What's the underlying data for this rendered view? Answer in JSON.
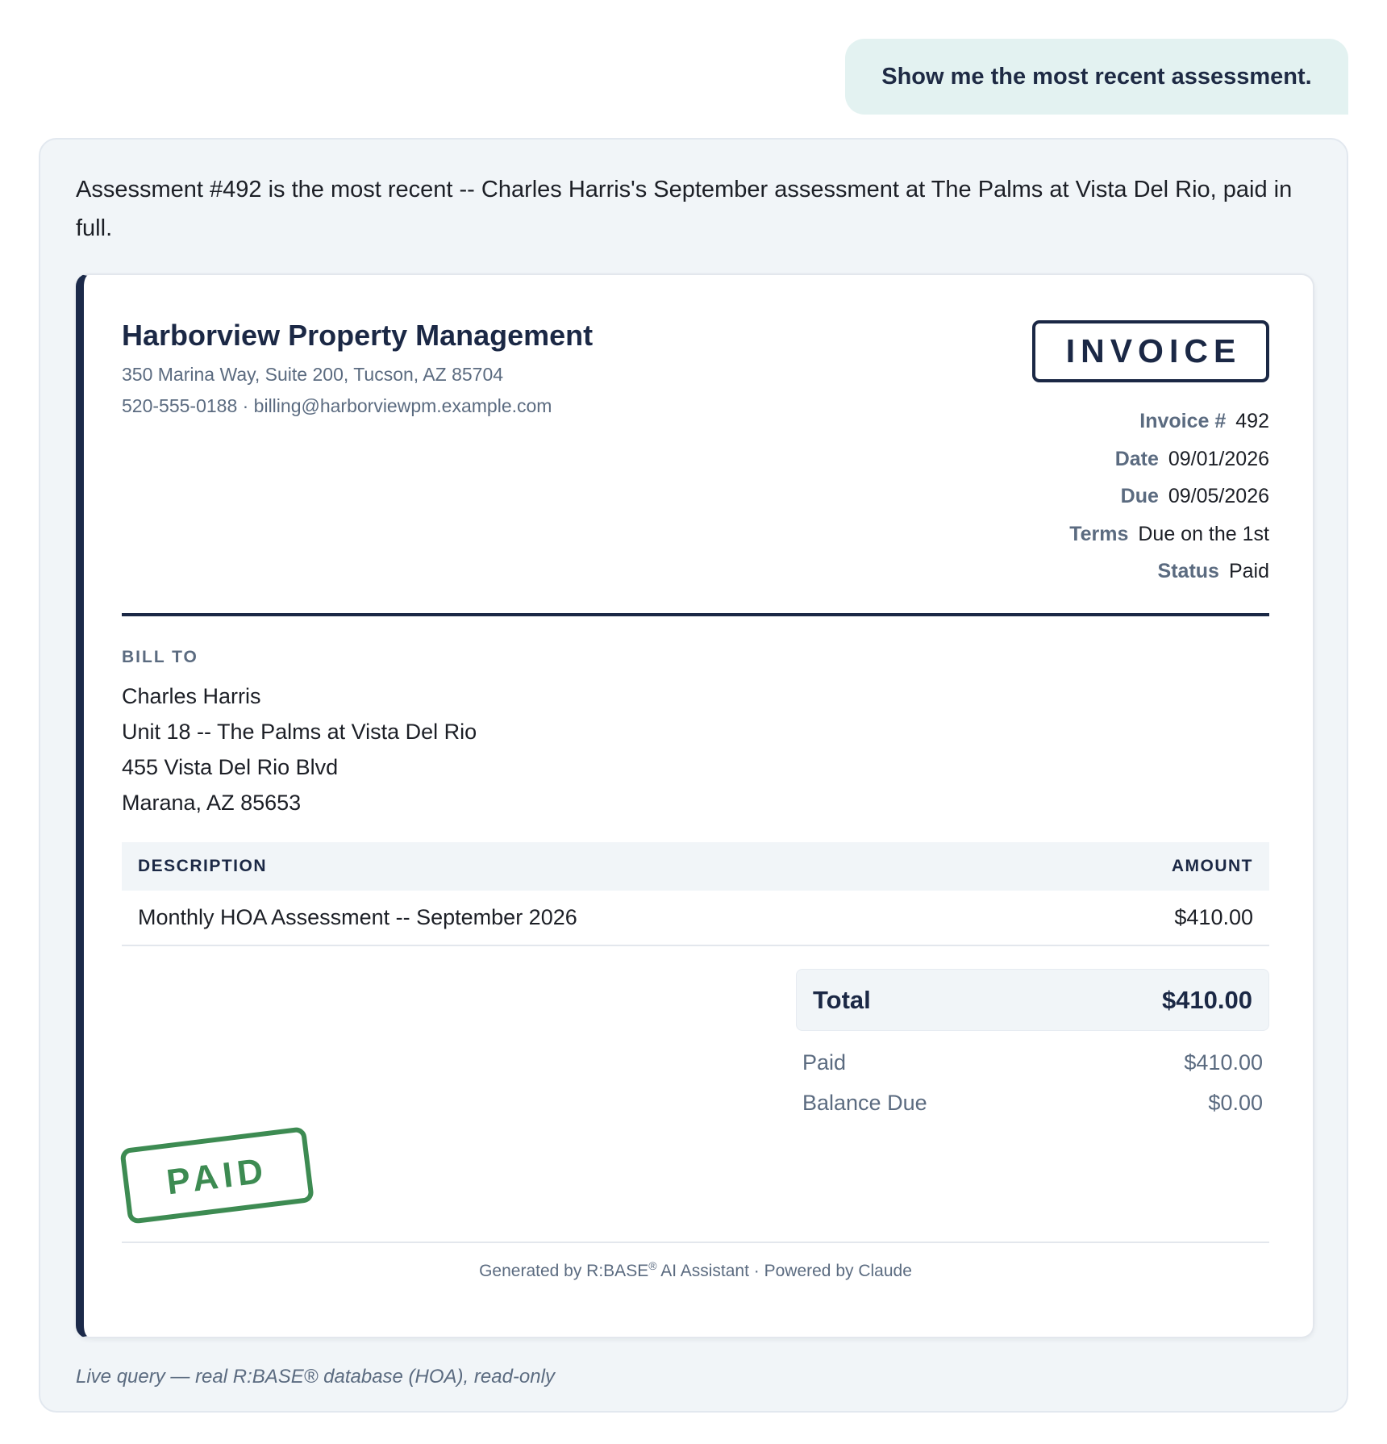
{
  "user_message": "Show me the most recent assessment.",
  "assistant": {
    "summary": "Assessment #492 is the most recent -- Charles Harris's September assessment at The Palms at Vista Del Rio, paid in full.",
    "source_note": "Live query — real R:BASE® database (HOA), read-only"
  },
  "invoice": {
    "company": {
      "name": "Harborview Property Management",
      "address": "350 Marina Way, Suite 200, Tucson, AZ 85704",
      "contact": "520-555-0188 · billing@harborviewpm.example.com"
    },
    "badge": "INVOICE",
    "meta": [
      {
        "label": "Invoice #",
        "value": "492"
      },
      {
        "label": "Date",
        "value": "09/01/2026"
      },
      {
        "label": "Due",
        "value": "09/05/2026"
      },
      {
        "label": "Terms",
        "value": "Due on the 1st"
      },
      {
        "label": "Status",
        "value": "Paid"
      }
    ],
    "bill_to": {
      "label": "BILL TO",
      "lines": [
        "Charles Harris",
        "Unit 18 -- The Palms at Vista Del Rio",
        "455 Vista Del Rio Blvd",
        "Marana, AZ 85653"
      ]
    },
    "table": {
      "headers": {
        "description": "DESCRIPTION",
        "amount": "AMOUNT"
      },
      "rows": [
        {
          "description": "Monthly HOA Assessment -- September 2026",
          "amount": "$410.00"
        }
      ]
    },
    "totals": {
      "total_label": "Total",
      "total_value": "$410.00",
      "paid_label": "Paid",
      "paid_value": "$410.00",
      "balance_label": "Balance Due",
      "balance_value": "$0.00"
    },
    "stamp": "PAID",
    "footer": {
      "prefix": "Generated by R:BASE",
      "registered": "®",
      "suffix": " AI Assistant · Powered by Claude"
    }
  },
  "colors": {
    "navy": "#1b2845",
    "stamp_green": "#3d8b52",
    "muted_text": "#5b6b80",
    "user_bubble": "#e3f2f1",
    "card_bg": "#f1f5f8"
  }
}
